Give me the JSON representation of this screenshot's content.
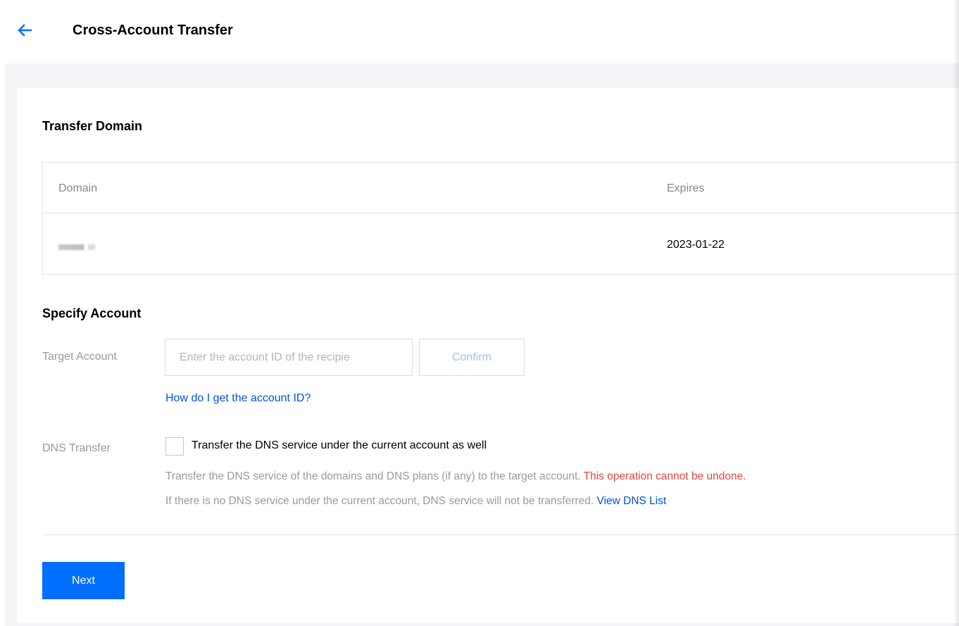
{
  "header": {
    "title": "Cross-Account Transfer",
    "back_icon": "arrow-left-icon",
    "accent": "#006eff"
  },
  "transfer_domain": {
    "title": "Transfer Domain",
    "columns": [
      "Domain",
      "Expires"
    ],
    "rows": [
      {
        "domain": "",
        "expires": "2023-01-22"
      }
    ]
  },
  "specify_account": {
    "title": "Specify Account",
    "target_label": "Target Account",
    "target_placeholder": "Enter the account ID of the recipie",
    "target_value": "",
    "confirm_label": "Confirm",
    "help_link": "How do I get the account ID?",
    "dns_label": "DNS Transfer",
    "dns_checkbox_label": "Transfer the DNS service under the current account as well",
    "dns_checked": false,
    "desc_line1_prefix": "Transfer the DNS service of the domains and DNS plans (if any) to the target account.",
    "desc_line1_warning": "This operation cannot be undone.",
    "desc_line2_prefix": "If there is no DNS service under the current account, DNS service will not be transferred.",
    "desc_line2_link": "View DNS List",
    "warning_color": "#e54545",
    "link_color": "#0052d9"
  },
  "footer": {
    "next_label": "Next"
  }
}
